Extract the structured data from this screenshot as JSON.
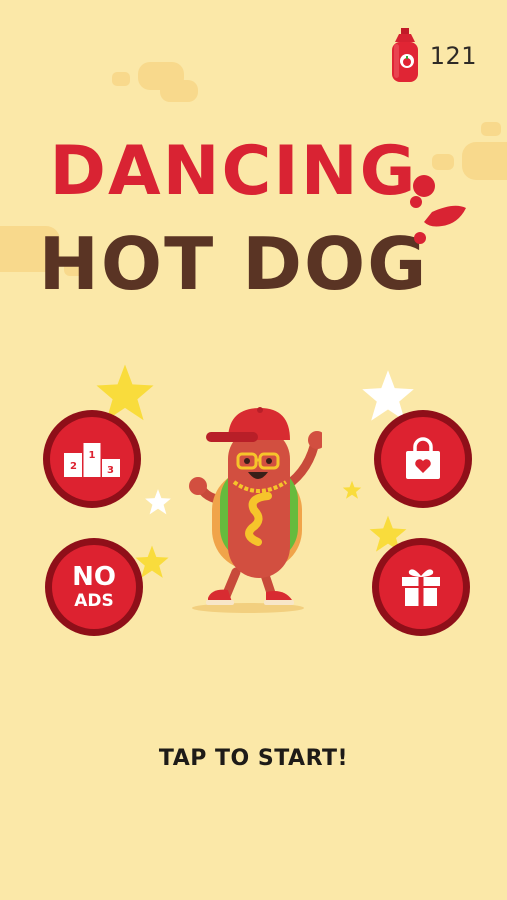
{
  "currency": {
    "icon": "ketchup-bottle-icon",
    "value": "121"
  },
  "title": {
    "line1": "DANCING",
    "line2": "HOT DOG"
  },
  "menu": {
    "leaderboard_icon": "podium-icon",
    "noads_line1": "NO",
    "noads_line2": "ADS",
    "shop_icon": "shopping-bag-heart-icon",
    "gift_icon": "gift-box-icon"
  },
  "prompt": "TAP TO START!",
  "colors": {
    "background": "#fbe8a8",
    "button_red": "#dd2230",
    "button_ring": "#8f0f19",
    "title_red": "#d92333",
    "title_brown": "#5a3424",
    "star_yellow": "#f9dc3c"
  }
}
